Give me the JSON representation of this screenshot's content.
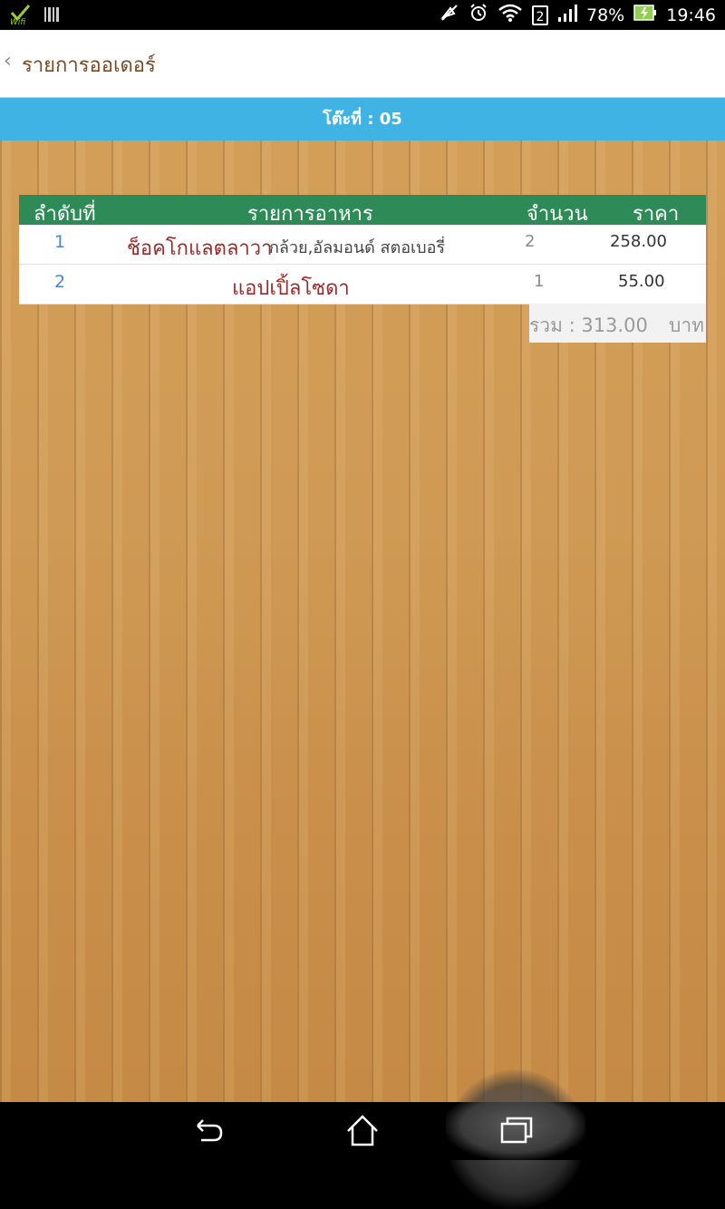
{
  "status_bar": {
    "battery": "78%",
    "time": "19:46",
    "sim_slot": "2",
    "icons": [
      "wifi-check-icon",
      "barcode-icon",
      "mute-icon",
      "alarm-icon",
      "wifi-icon",
      "sim-icon",
      "signal-icon",
      "battery-charging-icon"
    ]
  },
  "action_bar": {
    "back_glyph": "‹",
    "title": "รายการออเดอร์"
  },
  "table_bar": {
    "label": "โต๊ะที่ : 05"
  },
  "order": {
    "headers": {
      "no": "ลำดับที่",
      "item": "รายการอาหาร",
      "qty": "จำนวน",
      "price": "ราคา"
    },
    "rows": [
      {
        "no": "1",
        "name": "ช็อคโกแลตลาวา",
        "options": "กล้วย,อัลมอนด์ สตอเบอรี่",
        "qty": "2",
        "price": "258.00"
      },
      {
        "no": "2",
        "name": "แอปเปิ้ลโซดา",
        "options": "",
        "qty": "1",
        "price": "55.00"
      }
    ],
    "total_label": "รวม : 313.00",
    "total_unit": "บาท"
  },
  "colors": {
    "header_blue": "#3fb3e3",
    "table_head_green": "#2e8b57",
    "item_name_red": "#9b2a2a",
    "title_brown": "#7a4a24"
  }
}
